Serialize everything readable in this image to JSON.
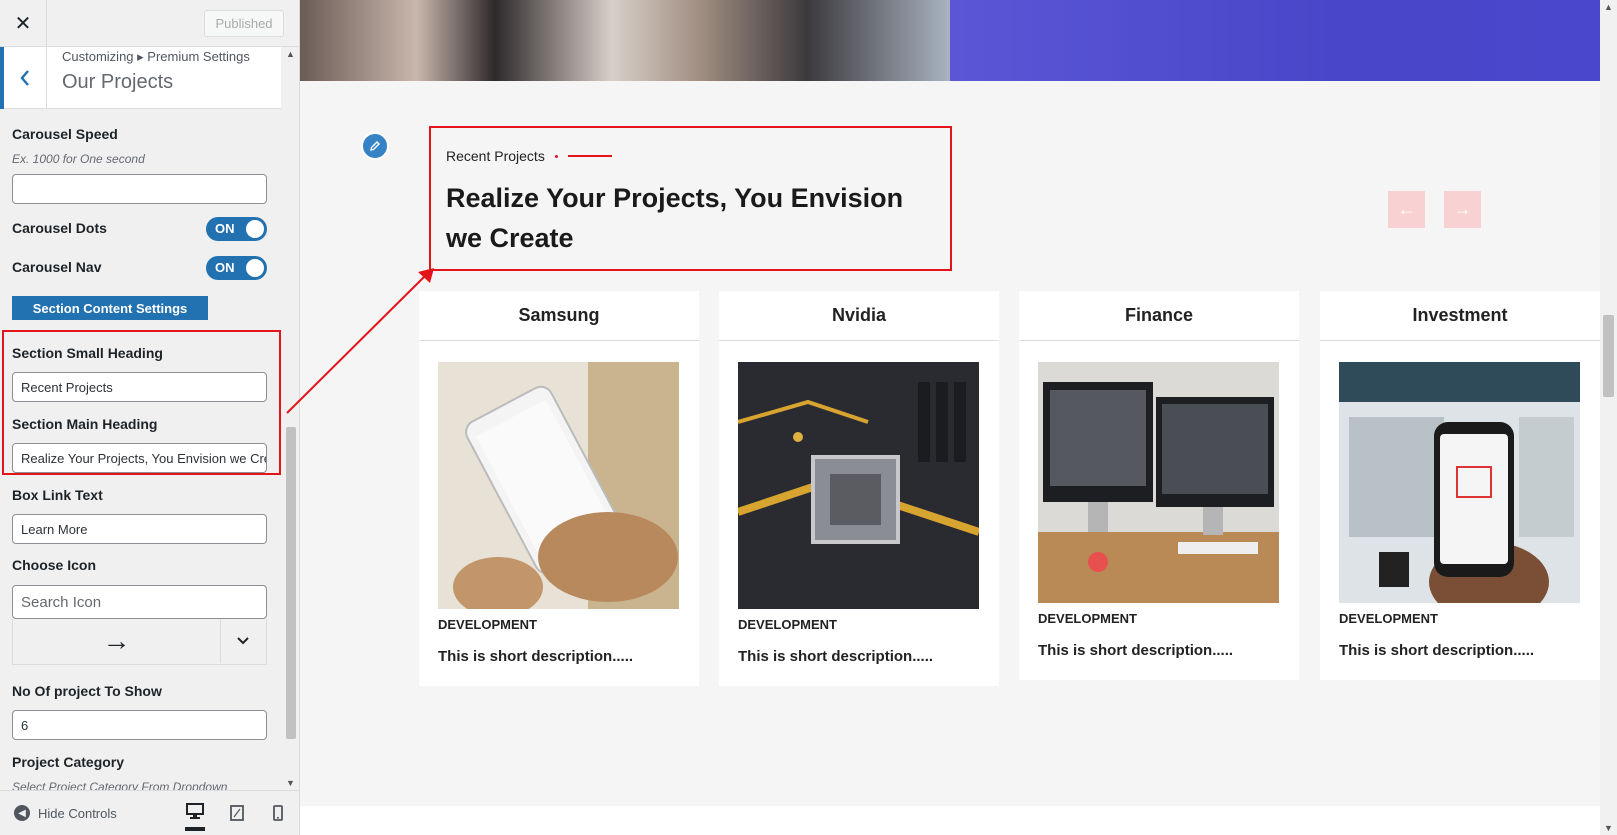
{
  "topbar": {
    "close": "✕",
    "publish_label": "Published"
  },
  "section": {
    "breadcrumb": "Customizing ▸ Premium Settings",
    "title": "Our Projects"
  },
  "fields": {
    "carousel_speed_label": "Carousel Speed",
    "carousel_speed_desc": "Ex. 1000 for One second",
    "carousel_speed_value": "",
    "carousel_dots_label": "Carousel Dots",
    "carousel_dots_state": "ON",
    "carousel_nav_label": "Carousel Nav",
    "carousel_nav_state": "ON",
    "content_settings_button": "Section Content Settings",
    "small_heading_label": "Section Small Heading",
    "small_heading_value": "Recent Projects",
    "main_heading_label": "Section Main Heading",
    "main_heading_value": "Realize Your Projects, You Envision we Create",
    "box_link_label": "Box Link Text",
    "box_link_value": "Learn More",
    "choose_icon_label": "Choose Icon",
    "search_icon_placeholder": "Search Icon",
    "selected_icon": "→",
    "icon_dropdown": "⌄",
    "projects_count_label": "No Of project To Show",
    "projects_count_value": "6",
    "project_category_label": "Project Category",
    "project_category_desc": "Select Project Category From Dropdown"
  },
  "footer": {
    "hide_controls": "Hide Controls"
  },
  "preview": {
    "small_heading": "Recent Projects",
    "main_heading": "Realize Your Projects, You Envision we Create",
    "prev_arrow": "←",
    "next_arrow": "→",
    "cards": [
      {
        "title": "Samsung",
        "category": "DEVELOPMENT",
        "description": "This is short description....."
      },
      {
        "title": "Nvidia",
        "category": "DEVELOPMENT",
        "description": "This is short description....."
      },
      {
        "title": "Finance",
        "category": "DEVELOPMENT",
        "description": "This is short description....."
      },
      {
        "title": "Investment",
        "category": "DEVELOPMENT",
        "description": "This is short description....."
      }
    ]
  },
  "colors": {
    "accent_blue": "#2271b1",
    "highlight_red": "#e3151a",
    "nav_pink": "#f8d2d2"
  }
}
